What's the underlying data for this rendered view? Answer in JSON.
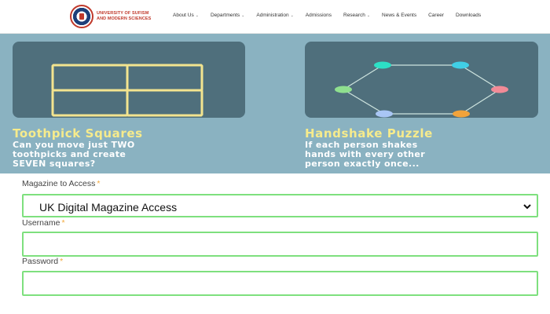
{
  "header": {
    "logo_line1": "UNIVERSITY OF SUFISM",
    "logo_line2": "AND MODERN SCIENCES",
    "nav": [
      {
        "label": "About Us",
        "dropdown": true
      },
      {
        "label": "Departments",
        "dropdown": true
      },
      {
        "label": "Administration",
        "dropdown": true
      },
      {
        "label": "Admissions",
        "dropdown": false
      },
      {
        "label": "Research",
        "dropdown": true
      },
      {
        "label": "News & Events",
        "dropdown": false
      },
      {
        "label": "Career",
        "dropdown": false
      },
      {
        "label": "Downloads",
        "dropdown": false
      }
    ]
  },
  "banner": {
    "left": {
      "title": "Toothpick Squares",
      "description": "Can you move just TWO\ntoothpicks and create\nSEVEN squares?"
    },
    "right": {
      "title": "Handshake Puzzle",
      "description": "If each person shakes\nhands with every other\nperson exactly once..."
    },
    "handshake_node_colors": [
      "#2de0c6",
      "#40cfe6",
      "#f28b97",
      "#f1a33b",
      "#a9c6f5",
      "#8fe08f"
    ]
  },
  "form": {
    "magazine_label": "Magazine to Access",
    "magazine_value": "UK Digital Magazine Access",
    "username_label": "Username",
    "password_label": "Password",
    "required_mark": "*"
  }
}
